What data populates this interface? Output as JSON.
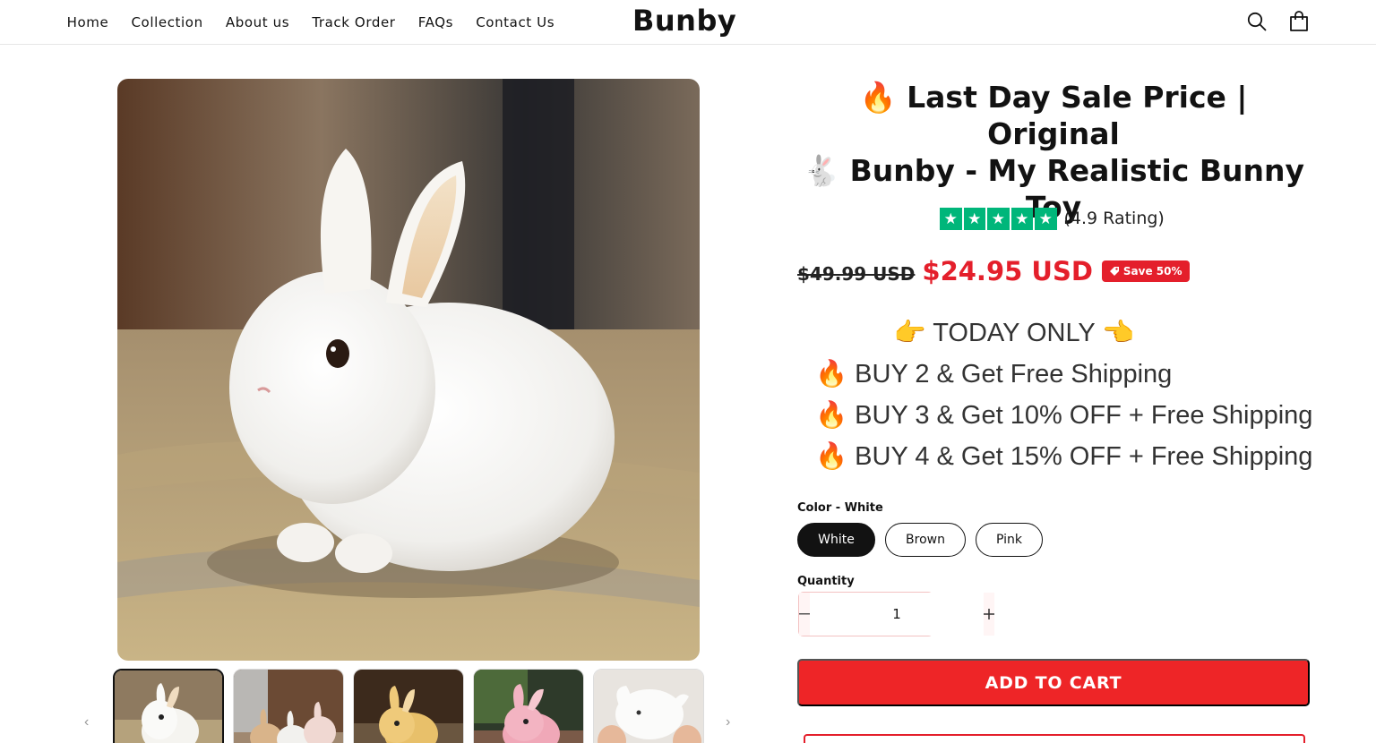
{
  "header": {
    "nav": [
      "Home",
      "Collection",
      "About us",
      "Track Order",
      "FAQs",
      "Contact Us"
    ],
    "logo": "Bunby",
    "icons": [
      "search-icon",
      "shopping-bag-icon"
    ]
  },
  "gallery": {
    "main_image": "white fluffy bunny toy on rug",
    "thumbnails": [
      "white-bunny",
      "three-bunnies",
      "yellow-bunny",
      "pink-bunny",
      "bunny-in-hands"
    ],
    "prev_icon": "chevron-left-icon",
    "next_icon": "chevron-right-icon"
  },
  "product": {
    "title_line1": "🔥 Last Day Sale Price | Original",
    "title_line2": "🐇 Bunby - My Realistic Bunny",
    "title_line3": "Toy",
    "rating_stars": 5,
    "rating_text": "(4.9 Rating)",
    "old_price": "$49.99 USD",
    "new_price": "$24.95 USD",
    "save_badge": "Save 50%",
    "promo": {
      "today": "👉 TODAY ONLY 👈",
      "lines": [
        "🔥 BUY 2 & Get Free Shipping",
        "🔥 BUY 3 & Get 10% OFF + Free Shipping",
        "🔥 BUY 4 & Get 15% OFF + Free Shipping"
      ]
    },
    "color_label": "Color - White",
    "colors": [
      "White",
      "Brown",
      "Pink"
    ],
    "selected_color": "White",
    "quantity_label": "Quantity",
    "quantity_value": "1",
    "add_to_cart": "ADD TO CART"
  },
  "colors": {
    "accent_red": "#ee2527",
    "price_red": "#e41f2b",
    "trustpilot_green": "#00b67a"
  }
}
